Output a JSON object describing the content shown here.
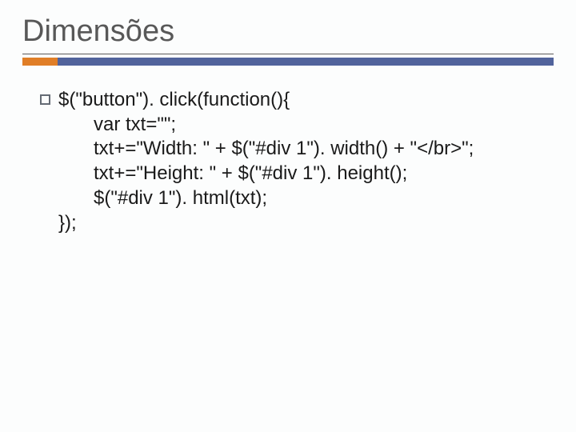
{
  "title": "Dimensões",
  "code": {
    "l1": "$(\"button\"). click(function(){",
    "l2": "var txt=\"\";",
    "l3": "txt+=\"Width: \" + $(\"#div 1\"). width() + \"</br>\";",
    "l4": "txt+=\"Height: \" + $(\"#div 1\"). height();",
    "l5": "$(\"#div 1\"). html(txt);",
    "l6": "});"
  }
}
